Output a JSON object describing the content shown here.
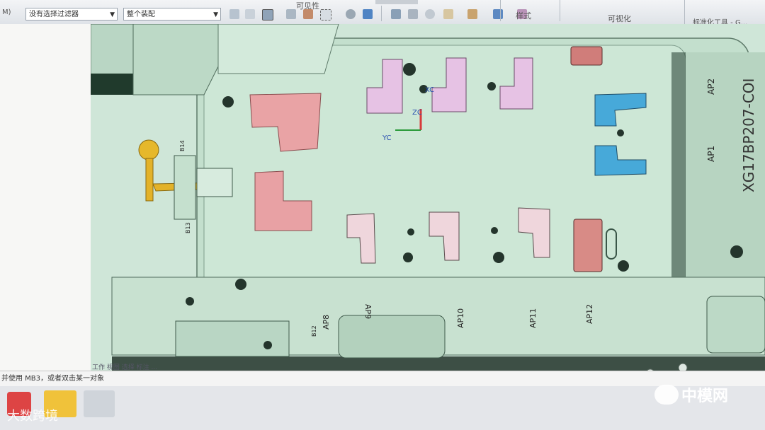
{
  "toolbar": {
    "menu_stub": "M)",
    "filter_combo": "没有选择过滤器",
    "scope_combo": "整个装配",
    "group_visibility": "可见性",
    "group_style": "样式",
    "group_visualize": "可视化",
    "std_tools": "标准化工具 - G..."
  },
  "model": {
    "part_number": "XG17BP207-COI",
    "labels_right": [
      "AP2",
      "AP1"
    ],
    "labels_bottom": [
      "AP8",
      "AP9",
      "AP10",
      "AP11",
      "AP12"
    ],
    "small_labels": [
      "B14",
      "B13",
      "B12"
    ],
    "axis": [
      "XC",
      "YC",
      "ZC"
    ]
  },
  "status": {
    "line1": "工作 视图 选择 标注 ...",
    "line2": "并使用 MB3，或者双击某一对象"
  },
  "watermarks": {
    "left": "大数跨境",
    "right": "中模网"
  },
  "colors": {
    "model_bg": "#cfe6d8",
    "plate": "#c3dfcd",
    "pink": "#e9a3a5",
    "salmon": "#d88b86",
    "lavender": "#e6c2e4",
    "blue": "#47a9d9",
    "yellow": "#e6b82b"
  }
}
